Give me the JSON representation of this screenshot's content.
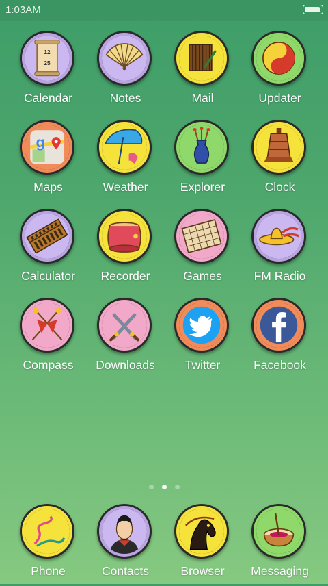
{
  "status_bar": {
    "time": "1:03AM",
    "battery_level": 0.9
  },
  "apps": [
    {
      "label": "Calendar",
      "icon": "calendar-icon",
      "ring": "#b8a4e0",
      "calendar_line1": "12",
      "calendar_line2": "25"
    },
    {
      "label": "Notes",
      "icon": "folding-fan-icon",
      "ring": "#b8a4e0"
    },
    {
      "label": "Mail",
      "icon": "scroll-brush-icon",
      "ring": "#f5e23a"
    },
    {
      "label": "Updater",
      "icon": "yin-yang-icon",
      "ring": "#8fd96a"
    },
    {
      "label": "Maps",
      "icon": "maps-icon",
      "ring": "#f28b5a"
    },
    {
      "label": "Weather",
      "icon": "umbrella-icon",
      "ring": "#f5e23a"
    },
    {
      "label": "Explorer",
      "icon": "vase-icon",
      "ring": "#8fd96a"
    },
    {
      "label": "Clock",
      "icon": "bell-icon",
      "ring": "#f5e23a"
    },
    {
      "label": "Calculator",
      "icon": "abacus-icon",
      "ring": "#b8a4e0"
    },
    {
      "label": "Recorder",
      "icon": "drum-icon",
      "ring": "#f5e23a"
    },
    {
      "label": "Games",
      "icon": "board-game-icon",
      "ring": "#f2a8c8"
    },
    {
      "label": "FM Radio",
      "icon": "hat-icon",
      "ring": "#b8a4e0"
    },
    {
      "label": "Compass",
      "icon": "crossed-flags-icon",
      "ring": "#f2a8c8"
    },
    {
      "label": "Downloads",
      "icon": "crossed-swords-icon",
      "ring": "#f2a8c8"
    },
    {
      "label": "Twitter",
      "icon": "twitter-bird-icon",
      "ring": "#f28b5a"
    },
    {
      "label": "Facebook",
      "icon": "facebook-f-icon",
      "ring": "#f28b5a"
    }
  ],
  "page_indicator": {
    "pages": 3,
    "current": 2
  },
  "dock": [
    {
      "label": "Phone",
      "icon": "phone-cord-icon",
      "ring": "#f5e23a"
    },
    {
      "label": "Contacts",
      "icon": "warrior-portrait-icon",
      "ring": "#b8a4e0"
    },
    {
      "label": "Browser",
      "icon": "horse-icon",
      "ring": "#f5e23a"
    },
    {
      "label": "Messaging",
      "icon": "ink-pot-icon",
      "ring": "#8fd96a"
    }
  ]
}
